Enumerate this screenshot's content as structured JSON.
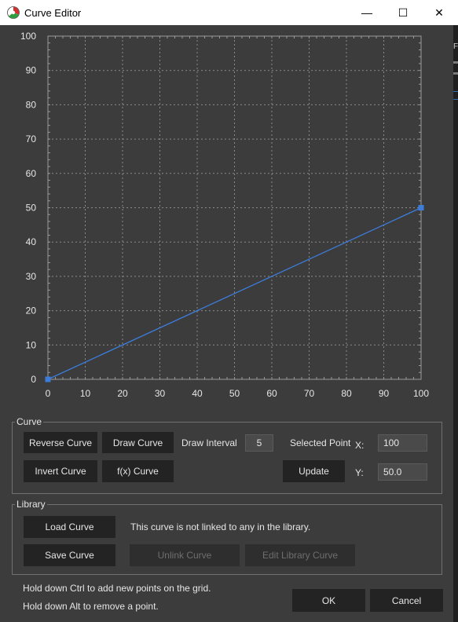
{
  "window": {
    "title": "Curve Editor",
    "controls": [
      "—",
      "☐",
      "✕"
    ]
  },
  "chart_data": {
    "type": "line",
    "xlim": [
      0,
      100
    ],
    "ylim": [
      0,
      100
    ],
    "x_ticks": [
      0,
      10,
      20,
      30,
      40,
      50,
      60,
      70,
      80,
      90,
      100
    ],
    "y_ticks": [
      0,
      10,
      20,
      30,
      40,
      50,
      60,
      70,
      80,
      90,
      100
    ],
    "grid": true,
    "series": [
      {
        "points": [
          [
            0,
            0
          ],
          [
            100,
            50
          ]
        ],
        "color": "#3c7ddc"
      }
    ]
  },
  "curve_group": {
    "label": "Curve",
    "reverse": "Reverse Curve",
    "draw": "Draw Curve",
    "invert": "Invert Curve",
    "fx": "f(x) Curve",
    "draw_interval_label": "Draw Interval",
    "draw_interval_value": "5",
    "selected_point_label": "Selected Point",
    "x_label": "X:",
    "x_value": "100",
    "y_label": "Y:",
    "y_value": "50.0",
    "update": "Update"
  },
  "library_group": {
    "label": "Library",
    "load": "Load Curve",
    "save": "Save Curve",
    "status": "This curve is not linked to any in the library.",
    "unlink": "Unlink Curve",
    "edit": "Edit Library Curve"
  },
  "hints": {
    "ctrl": "Hold down Ctrl to add new points on the grid.",
    "alt": "Hold down Alt to remove a point."
  },
  "footer": {
    "ok": "OK",
    "cancel": "Cancel"
  },
  "background_fragment": "F"
}
